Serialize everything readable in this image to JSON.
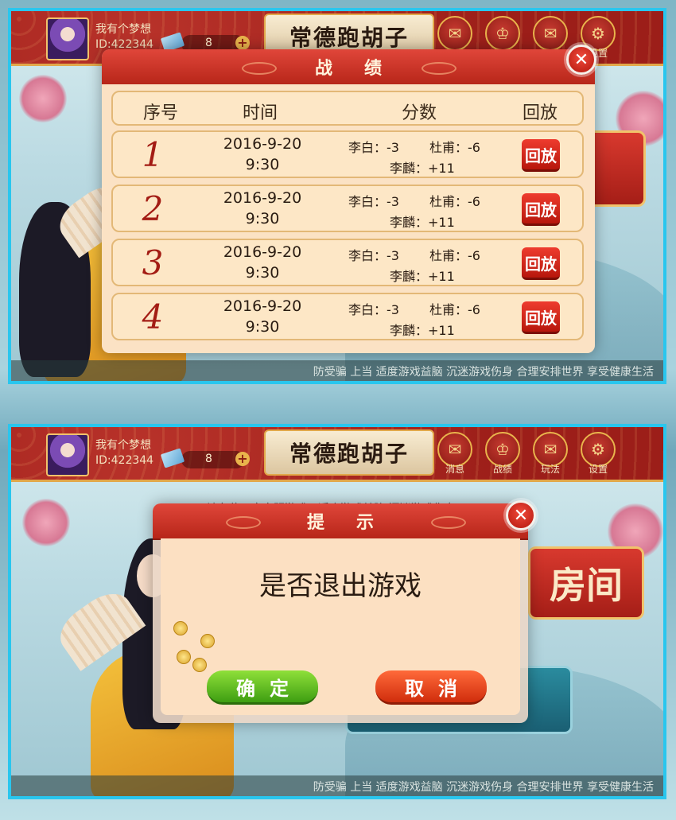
{
  "header": {
    "nickname": "我有个梦想",
    "user_id": "ID:422344",
    "user_id_partial": "ID:422344",
    "room_cards": "8",
    "game_title": "常德跑胡子",
    "buttons": [
      {
        "label": "消息",
        "icon": "mail-icon"
      },
      {
        "label": "战绩",
        "icon": "medal-icon"
      },
      {
        "label": "玩法",
        "icon": "mail-icon"
      },
      {
        "label": "设置",
        "icon": "gear-icon"
      }
    ]
  },
  "ticker_top": "防受骗 上当 适度游戏益脑 沉迷游戏伤身 合理安排世界 享受健康生活",
  "ticker_bottom": "防受骗 上当 适度游戏益脑 沉迷游戏伤身 合理安排世界 享受健康生活",
  "bg_notice": "请各位玩家文明游戏，适度游戏益脑 沉迷游戏伤身",
  "bg_room_button": "房间",
  "record_dialog": {
    "title": "战绩",
    "columns": {
      "index": "序号",
      "time": "时间",
      "score": "分数",
      "replay": "回放"
    },
    "rows": [
      {
        "index": "1",
        "date": "2016-9-20",
        "time": "9:30",
        "score_a": "李白：-3",
        "score_b": "杜甫：-6",
        "score_c": "李麟：+11",
        "replay": "回放"
      },
      {
        "index": "2",
        "date": "2016-9-20",
        "time": "9:30",
        "score_a": "李白：-3",
        "score_b": "杜甫：-6",
        "score_c": "李麟：+11",
        "replay": "回放"
      },
      {
        "index": "3",
        "date": "2016-9-20",
        "time": "9:30",
        "score_a": "李白：-3",
        "score_b": "杜甫：-6",
        "score_c": "李麟：+11",
        "replay": "回放"
      },
      {
        "index": "4",
        "date": "2016-9-20",
        "time": "9:30",
        "score_a": "李白：-3",
        "score_b": "杜甫：-6",
        "score_c": "李麟：+11",
        "replay": "回放"
      }
    ]
  },
  "tip_dialog": {
    "title": "提示",
    "message": "是否退出游戏",
    "confirm": "确定",
    "cancel": "取消"
  },
  "icons": {
    "close": "close-icon",
    "plus": "plus-icon"
  },
  "colors": {
    "accent_red": "#b72619",
    "frame_cyan": "#29c6ee",
    "gold": "#e2a84a"
  }
}
